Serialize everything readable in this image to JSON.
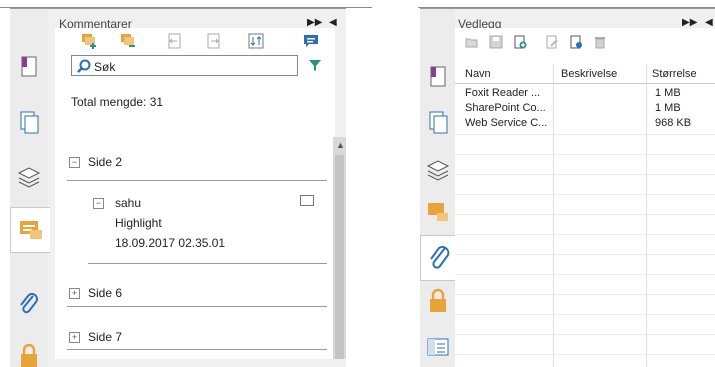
{
  "comments_panel": {
    "title": "Kommentarer",
    "search_label": "Søk",
    "total_label": "Total mengde: 31",
    "groups": [
      {
        "label": "Side 2",
        "expanded": true
      },
      {
        "label": "Side 6",
        "expanded": false
      },
      {
        "label": "Side 7",
        "expanded": false
      }
    ],
    "annotation": {
      "author": "sahu",
      "type": "Highlight",
      "timestamp": "18.09.2017 02.35.01"
    }
  },
  "attachments_panel": {
    "title": "Vedlegg",
    "columns": [
      "Navn",
      "Beskrivelse",
      "Størrelse"
    ],
    "rows": [
      {
        "name": "Foxit Reader ...",
        "description": "",
        "size": "1 MB"
      },
      {
        "name": "SharePoint Co...",
        "description": "",
        "size": "1 MB"
      },
      {
        "name": "Web Service C...",
        "description": "",
        "size": "968 KB"
      }
    ]
  },
  "colors": {
    "accent_teal": "#2f8f88",
    "accent_orange": "#e8a33a",
    "accent_blue": "#2b6fb5"
  }
}
